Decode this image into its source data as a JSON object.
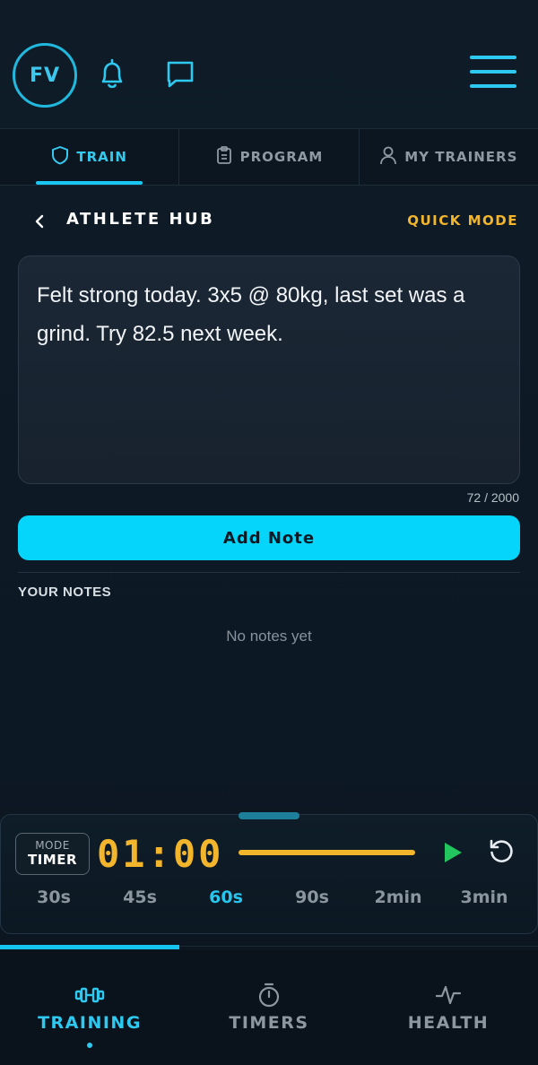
{
  "header": {
    "avatar_initials": "FV",
    "icons": [
      "bell-icon",
      "chat-icon",
      "menu-icon"
    ],
    "accent_color": "#21b8dd"
  },
  "tabs": [
    {
      "label": "TRAIN",
      "icon": "shield-icon",
      "active": true
    },
    {
      "label": "PROGRAM",
      "icon": "clipboard-icon",
      "active": false
    },
    {
      "label": "MY TRAINERS",
      "icon": "user-icon",
      "active": false
    }
  ],
  "subheader": {
    "title": "ATHLETE HUB",
    "quick_mode": "QUICK MODE",
    "quick_mode_color": "#f3b52c"
  },
  "note": {
    "value": "Felt strong today. 3x5 @ 80kg, last set was a grind. Try 82.5 next week.",
    "counter": "72 / 2000",
    "add_button": "Add Note"
  },
  "notes_section": {
    "label": "YOUR NOTES",
    "empty_text": "No notes yet"
  },
  "timer": {
    "mode_top": "MODE",
    "mode_bottom": "TIMER",
    "time": "01:00",
    "progress": 1.0,
    "presets": [
      {
        "label": "30s",
        "active": false
      },
      {
        "label": "45s",
        "active": false
      },
      {
        "label": "60s",
        "active": true
      },
      {
        "label": "90s",
        "active": false
      },
      {
        "label": "2min",
        "active": false
      },
      {
        "label": "3min",
        "active": false
      }
    ],
    "play_color": "#22c55e"
  },
  "bottom_nav": [
    {
      "label": "TRAINING",
      "icon": "dumbbell-icon",
      "active": true
    },
    {
      "label": "TIMERS",
      "icon": "stopwatch-icon",
      "active": false
    },
    {
      "label": "HEALTH",
      "icon": "heartbeat-icon",
      "active": false
    }
  ]
}
